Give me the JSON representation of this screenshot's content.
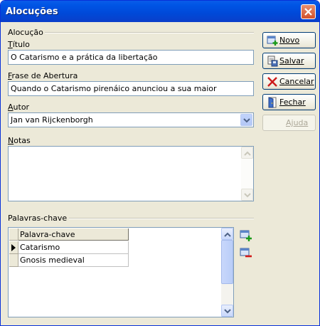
{
  "window": {
    "title": "Alocuções"
  },
  "section": {
    "label": "Alocução"
  },
  "fields": {
    "titulo": {
      "label_u": "T",
      "label_rest": "ítulo",
      "value": "O Catarismo e a prática da libertação"
    },
    "frase": {
      "label_u": "F",
      "label_rest": "rase de Abertura",
      "value": "Quando o Catarismo pirenáico anunciou a sua maior"
    },
    "autor": {
      "label_u": "A",
      "label_rest": "utor",
      "value": "Jan van Rijckenborgh"
    },
    "notas": {
      "label_u": "N",
      "label_rest": "otas",
      "value": ""
    }
  },
  "buttons": {
    "novo": {
      "label": "Novo",
      "icon": "new-record-icon"
    },
    "salvar": {
      "label": "Salvar",
      "icon": "save-icon"
    },
    "cancelar": {
      "label": "Cancelar",
      "icon": "cancel-x-icon"
    },
    "fechar": {
      "label": "Fechar",
      "icon": "door-exit-icon"
    },
    "ajuda": {
      "label": "Ajuda",
      "disabled": true
    }
  },
  "keywords": {
    "section_label": "Palavras-chave",
    "column_header": "Palavra-chave",
    "rows": [
      "Catarismo",
      "Gnosis medieval"
    ],
    "current_row": 0
  },
  "colors": {
    "titlebar": "#0055e5",
    "window_bg": "#ece9d8",
    "accent_border": "#003c74"
  }
}
